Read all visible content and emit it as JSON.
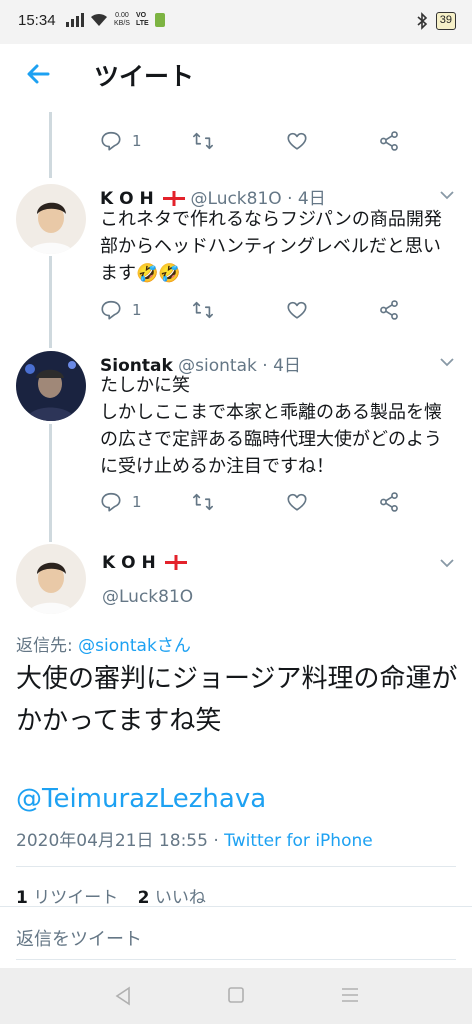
{
  "status": {
    "time": "15:34",
    "net_speed_top": "0.00",
    "net_speed_bottom": "KB/S",
    "volte_top": "VO",
    "volte_bottom": "LTE",
    "battery": "39"
  },
  "header": {
    "title": "ツイート"
  },
  "tweets": [
    {
      "reply_count": "1"
    },
    {
      "name": "K O H",
      "handle": "@Luck81O",
      "time": "· 4日",
      "text": "これネタで作れるならフジパンの商品開発部からヘッドハンティングレベルだと思います🤣🤣",
      "reply_count": "1"
    },
    {
      "name": "Siontak",
      "handle": "@siontak",
      "time": "· 4日",
      "text": "たしかに笑\nしかしここまで本家と乖離のある製品を懐の広さで定評ある臨時代理大使がどのように受け止めるか注目ですね！",
      "reply_count": "1"
    }
  ],
  "main_tweet": {
    "name": "K O H",
    "handle": "@Luck81O",
    "reply_to_label": "返信先:",
    "reply_to_user": "@siontakさん",
    "text": "大使の審判にジョージア料理の命運がかかってますね笑",
    "mention": "@TeimurazLezhava",
    "datetime": "2020年04月21日 18:55",
    "separator": " · ",
    "source": "Twitter for iPhone",
    "retweet_count": "1",
    "retweet_label": "リツイート",
    "like_count": "2",
    "like_label": "いいね"
  },
  "reply_box": {
    "placeholder": "返信をツイート"
  },
  "colors": {
    "accent": "#1da1f2",
    "muted": "#657786",
    "text": "#14171a"
  },
  "icons": [
    "back-arrow-icon",
    "reply-icon",
    "retweet-icon",
    "like-icon",
    "share-icon",
    "chevron-down-icon",
    "georgia-flag-icon"
  ]
}
